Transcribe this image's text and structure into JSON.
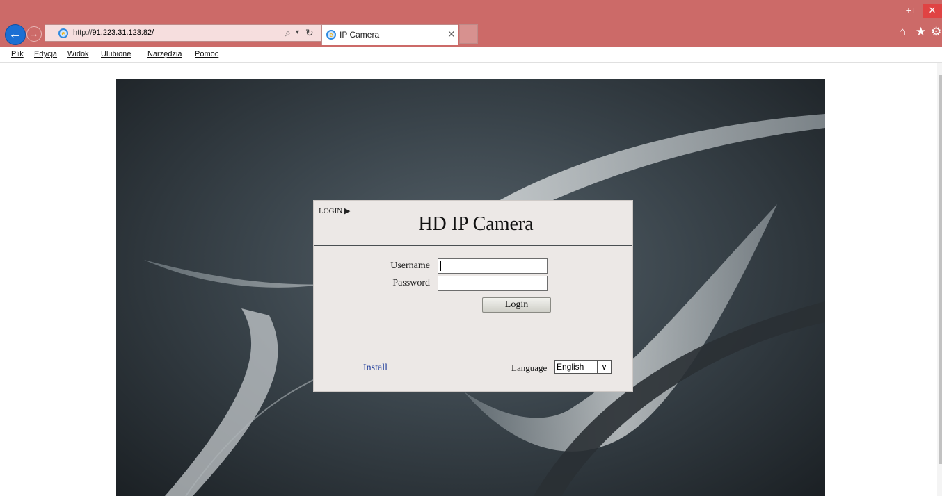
{
  "browser": {
    "window_controls": {
      "minimize": "–",
      "maximize": "□",
      "close": "✕"
    },
    "address": {
      "scheme": "http://",
      "host": "91.223.31.123:82/"
    },
    "tab": {
      "title": "IP Camera",
      "close": "✕"
    },
    "menu": [
      "Plik",
      "Edycja",
      "Widok",
      "Ulubione",
      "Narzędzia",
      "Pomoc"
    ],
    "icons": [
      "back-arrow-icon",
      "forward-arrow-icon",
      "search-icon",
      "refresh-icon",
      "home-icon",
      "star-icon",
      "gear-icon"
    ]
  },
  "login": {
    "tag": "LOGIN ▶",
    "title": "HD IP Camera",
    "username_label": "Username",
    "password_label": "Password",
    "username_value": "",
    "password_value": "",
    "login_button": "Login",
    "install_link": "Install",
    "language_label": "Language",
    "language_selected": "English"
  }
}
